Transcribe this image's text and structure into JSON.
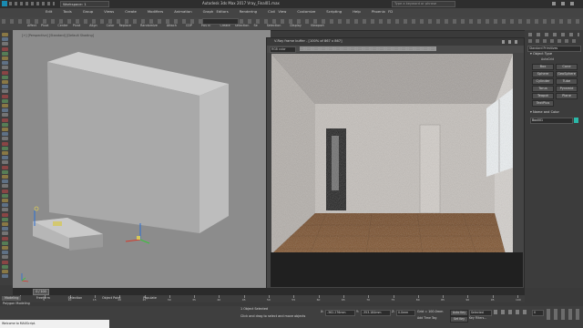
{
  "titlebar": {
    "workspace": "Workspace: 1",
    "title": "Autodesk 3ds Max 2017     Vray_Final01.max",
    "search_placeholder": "Type a keyword or phrase"
  },
  "menubar": {
    "items": [
      "Edit",
      "Tools",
      "Group",
      "Views",
      "Create",
      "Modifiers",
      "Animation",
      "Graph Editors",
      "Rendering",
      "Civil View",
      "Customize",
      "Scripting",
      "Help",
      "Phoenix FD"
    ]
  },
  "ribbon": {
    "items": [
      "Affect Pivot",
      "Center Pivot",
      "Align",
      "Color Replace",
      "Randomize",
      "Attach",
      "CDP",
      "PASTE",
      "Create Selection Se",
      "Selection",
      "Display",
      "Viewport"
    ]
  },
  "viewport": {
    "label": "[+] [Perspective] [Standard] [Default Shading]"
  },
  "vfb": {
    "title": "V-Ray frame buffer - [100% of 867 x 867]",
    "channel": "RGB color",
    "status": "Rendering image (pass 1) [00:00:02.3] [00:78:45.9 est]",
    "colors": {
      "wall": "#c9c4bf",
      "floor": "#7a4a26",
      "window": "#eef2f4"
    }
  },
  "right_panel": {
    "dropdown": "Standard Primitives",
    "object_type_header": "Object Type",
    "autogrid": "AutoGrid",
    "buttons": [
      "Box",
      "Cone",
      "Sphere",
      "GeoSphere",
      "Cylinder",
      "Tube",
      "Torus",
      "Pyramid",
      "Teapot",
      "Plane",
      "TextPlus"
    ],
    "name_color_header": "Name and Color",
    "object_name": "Box001",
    "object_color": "#2ab8a8"
  },
  "timeline": {
    "frame_label": "0 / 100",
    "ticks": [
      "0",
      "5",
      "10",
      "15",
      "20",
      "25",
      "30",
      "35",
      "40",
      "45",
      "50",
      "55",
      "60",
      "65",
      "70",
      "75",
      "80",
      "85",
      "90",
      "95",
      "100"
    ]
  },
  "statusbar": {
    "tabs": [
      "Modeling",
      "Freeform",
      "Selection",
      "Object Paint",
      "Populate"
    ],
    "sublabel": "Polygon Modeling",
    "script_text": "Welcome to MAXScript.",
    "selected": "1 Object Selected",
    "prompt": "Click and drag to select and move objects",
    "x_label": "X:",
    "x_value": "-362.276mm",
    "y_label": "Y:",
    "y_value": "-353.184mm",
    "z_label": "Z:",
    "z_value": "0.0mm",
    "grid": "Grid = 100.0mm",
    "autokey": "Auto Key",
    "setkey": "Set Key",
    "selected_dd": "Selected",
    "key_filters": "Key Filters...",
    "add_time_tag": "Add Time Tag",
    "frame_num": "0"
  },
  "icons": [
    "menu-icon",
    "undo-icon",
    "redo-icon",
    "link-icon",
    "select-icon",
    "move-icon",
    "rotate-icon",
    "scale-icon",
    "snap-icon",
    "render-icon",
    "teapot-icon",
    "save-icon",
    "play-icon"
  ]
}
